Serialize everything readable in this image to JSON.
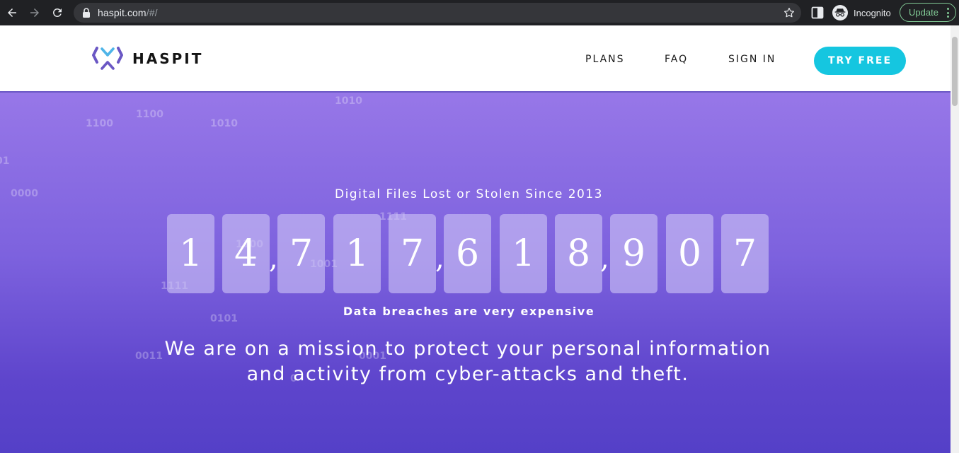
{
  "browser": {
    "url_host": "haspit.com",
    "url_path": "/#/",
    "profile_label": "Incognito",
    "update_label": "Update",
    "icons": [
      "back-icon",
      "forward-icon",
      "reload-icon",
      "lock-icon",
      "star-icon",
      "side-panel-icon",
      "incognito-icon",
      "kebab-menu-icon"
    ]
  },
  "header": {
    "brand": "HASPIT",
    "nav": [
      "PLANS",
      "FAQ",
      "SIGN IN"
    ],
    "cta": "TRY FREE"
  },
  "hero": {
    "kicker": "Digital Files Lost or Stolen Since 2013",
    "counter_digits": [
      "1",
      "4",
      "7",
      "1",
      "7",
      "6",
      "1",
      "8",
      "9",
      "0",
      "7"
    ],
    "separator": ",",
    "subheading": "Data breaches are very expensive",
    "mission_line1": "We are on a mission to protect your personal information",
    "mission_line2": "and activity from cyber-attacks and theft.",
    "binary_words": [
      "1100",
      "1100",
      "1010",
      "1010",
      "01",
      "0000",
      "1111",
      "1100",
      "1001",
      "1111",
      "0101",
      "0011",
      "0001",
      "0"
    ]
  },
  "colors": {
    "accent": "#15c6e0",
    "brand_purple": "#6a57c4",
    "hero_top": "#9777e8",
    "hero_bottom": "#5440c7"
  }
}
